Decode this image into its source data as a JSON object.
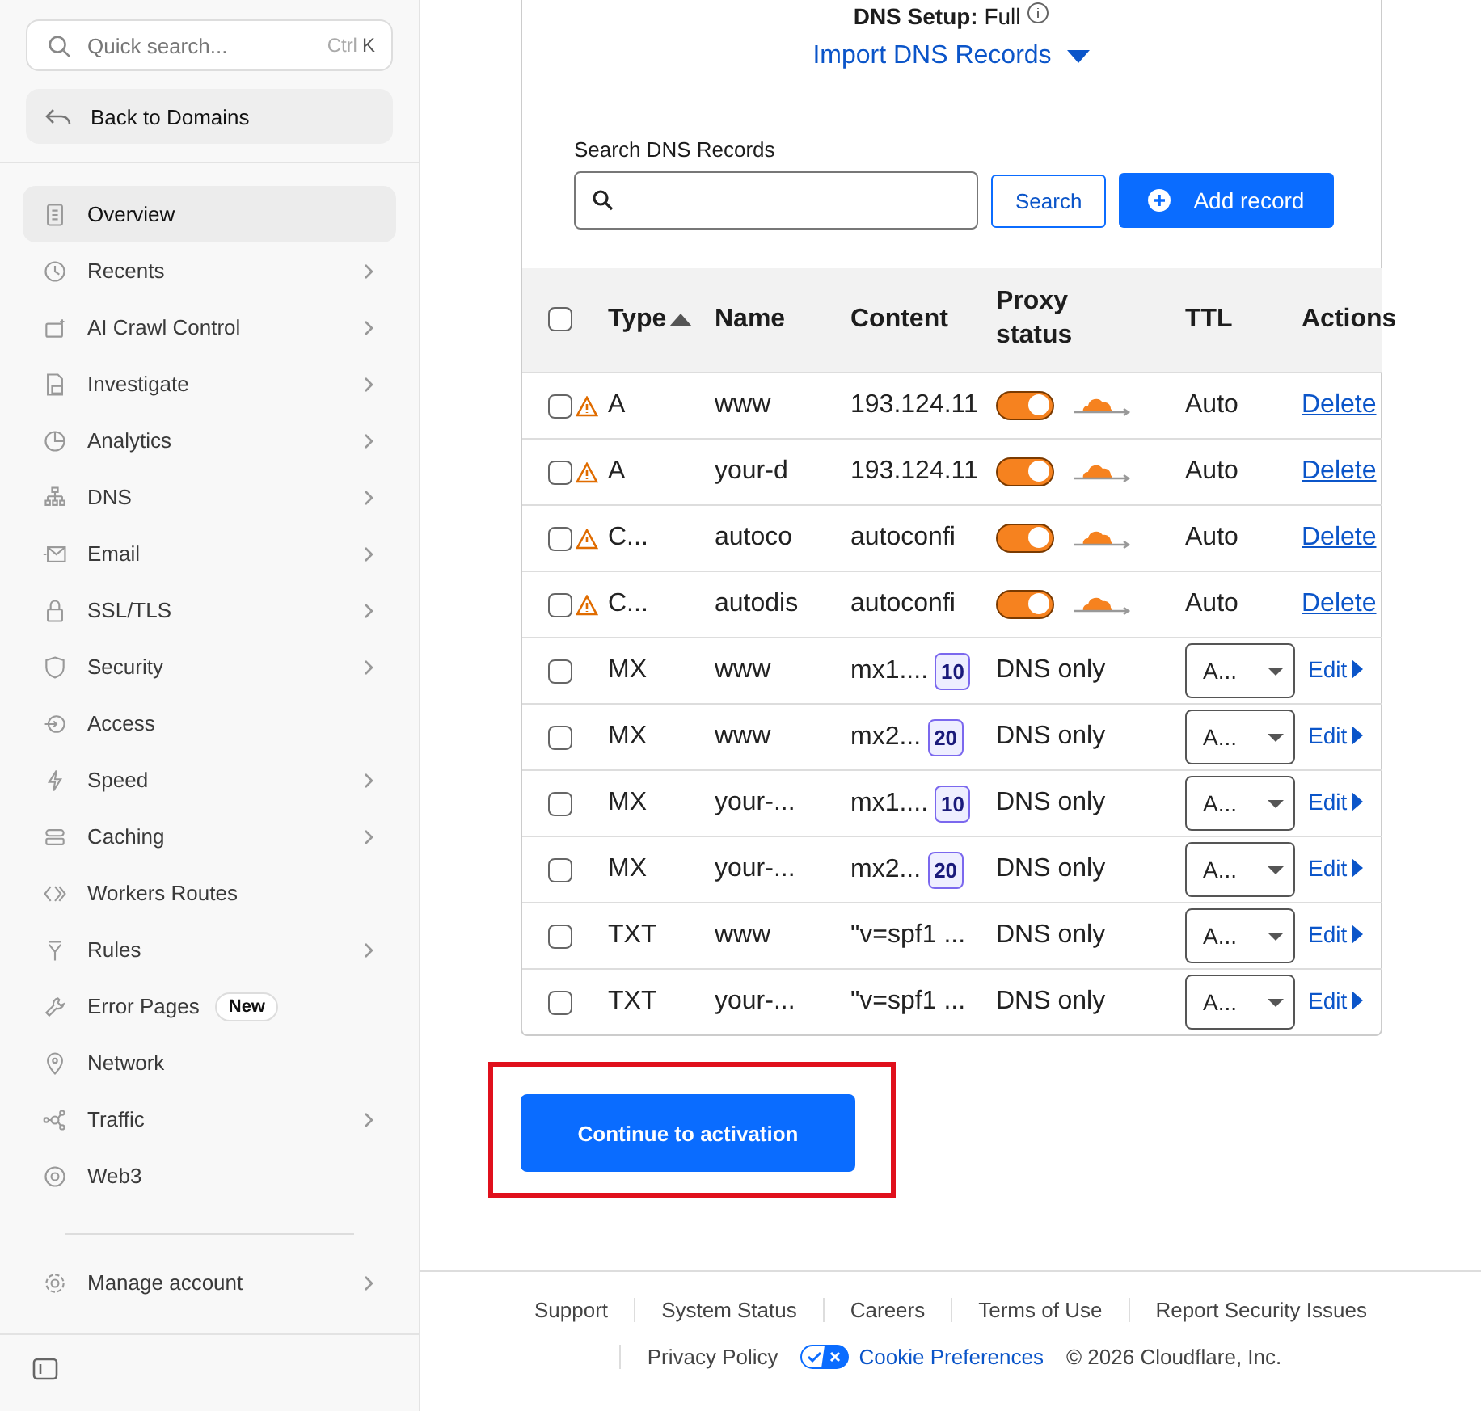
{
  "sidebar": {
    "search": {
      "placeholder": "Quick search...",
      "shortcut_modifier": "Ctrl",
      "shortcut_key": "K"
    },
    "back_button": "Back to Domains",
    "items": [
      {
        "label": "Overview",
        "selected": true,
        "expandable": false
      },
      {
        "label": "Recents",
        "selected": false,
        "expandable": true
      },
      {
        "label": "AI Crawl Control",
        "selected": false,
        "expandable": true
      },
      {
        "label": "Investigate",
        "selected": false,
        "expandable": true
      },
      {
        "label": "Analytics",
        "selected": false,
        "expandable": true
      },
      {
        "label": "DNS",
        "selected": false,
        "expandable": true
      },
      {
        "label": "Email",
        "selected": false,
        "expandable": true
      },
      {
        "label": "SSL/TLS",
        "selected": false,
        "expandable": true
      },
      {
        "label": "Security",
        "selected": false,
        "expandable": true
      },
      {
        "label": "Access",
        "selected": false,
        "expandable": false
      },
      {
        "label": "Speed",
        "selected": false,
        "expandable": true
      },
      {
        "label": "Caching",
        "selected": false,
        "expandable": true
      },
      {
        "label": "Workers Routes",
        "selected": false,
        "expandable": false
      },
      {
        "label": "Rules",
        "selected": false,
        "expandable": true
      },
      {
        "label": "Error Pages",
        "selected": false,
        "expandable": false,
        "badge": "New"
      },
      {
        "label": "Network",
        "selected": false,
        "expandable": false
      },
      {
        "label": "Traffic",
        "selected": false,
        "expandable": true
      },
      {
        "label": "Web3",
        "selected": false,
        "expandable": false
      }
    ],
    "account": {
      "label": "Manage account",
      "expandable": true
    }
  },
  "main": {
    "setup_label": "DNS Setup:",
    "setup_value": "Full",
    "import_link": "Import DNS Records",
    "search_label": "Search DNS Records",
    "search_button": "Search",
    "add_button": "Add record",
    "table": {
      "select_all_checked": false,
      "columns": [
        "Type",
        "Name",
        "Content",
        "Proxy status",
        "TTL",
        "Actions"
      ],
      "rows": [
        {
          "kind": "proxied",
          "checked": false,
          "warning": true,
          "type": "A",
          "name": "www",
          "content": "193.124.11",
          "proxy_on": true,
          "ttl": "Auto",
          "action": "Delete"
        },
        {
          "kind": "proxied",
          "checked": false,
          "warning": true,
          "type": "A",
          "name": "your-d",
          "content": "193.124.11",
          "proxy_on": true,
          "ttl": "Auto",
          "action": "Delete"
        },
        {
          "kind": "proxied",
          "checked": false,
          "warning": true,
          "type": "C...",
          "name": "autoco",
          "content": "autoconfi",
          "proxy_on": true,
          "ttl": "Auto",
          "action": "Delete"
        },
        {
          "kind": "proxied",
          "checked": false,
          "warning": true,
          "type": "C...",
          "name": "autodis",
          "content": "autoconfi",
          "proxy_on": true,
          "ttl": "Auto",
          "action": "Delete"
        },
        {
          "kind": "dns_only",
          "checked": false,
          "warning": false,
          "type": "MX",
          "name": "www",
          "content": "mx1....",
          "priority": "10",
          "proxy": "DNS only",
          "ttl": "A...",
          "action": "Edit"
        },
        {
          "kind": "dns_only",
          "checked": false,
          "warning": false,
          "type": "MX",
          "name": "www",
          "content": "mx2...",
          "priority": "20",
          "proxy": "DNS only",
          "ttl": "A...",
          "action": "Edit"
        },
        {
          "kind": "dns_only",
          "checked": false,
          "warning": false,
          "type": "MX",
          "name": "your-...",
          "content": "mx1....",
          "priority": "10",
          "proxy": "DNS only",
          "ttl": "A...",
          "action": "Edit"
        },
        {
          "kind": "dns_only",
          "checked": false,
          "warning": false,
          "type": "MX",
          "name": "your-...",
          "content": "mx2...",
          "priority": "20",
          "proxy": "DNS only",
          "ttl": "A...",
          "action": "Edit"
        },
        {
          "kind": "dns_only",
          "checked": false,
          "warning": false,
          "type": "TXT",
          "name": "www",
          "content": "\"v=spf1 ...",
          "proxy": "DNS only",
          "ttl": "A...",
          "action": "Edit"
        },
        {
          "kind": "dns_only",
          "checked": false,
          "warning": false,
          "type": "TXT",
          "name": "your-...",
          "content": "\"v=spf1 ...",
          "proxy": "DNS only",
          "ttl": "A...",
          "action": "Edit"
        }
      ]
    },
    "continue_button": "Continue to activation"
  },
  "footer": {
    "links": [
      "Support",
      "System Status",
      "Careers",
      "Terms of Use",
      "Report Security Issues"
    ],
    "privacy": "Privacy Policy",
    "cookie": "Cookie Preferences",
    "copyright": "© 2026 Cloudflare, Inc."
  }
}
